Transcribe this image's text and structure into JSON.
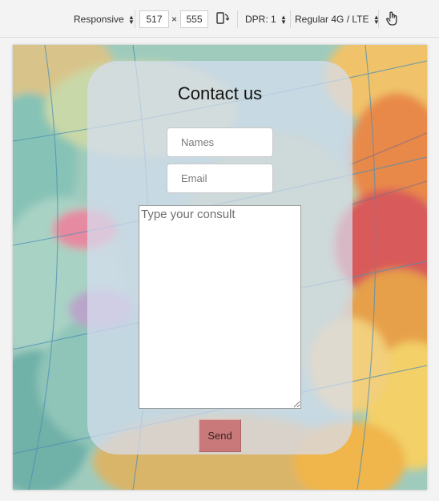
{
  "toolbar": {
    "device_mode": "Responsive",
    "width": "517",
    "times_sign": "×",
    "height": "555",
    "dpr_label": "DPR: 1",
    "throttling": "Regular 4G / LTE",
    "rotate_icon": "rotate-device-icon",
    "touch_icon": "touch-hand-icon"
  },
  "page": {
    "background_image": "vintage world map globe (Europe / North Sea)",
    "form": {
      "title": "Contact us",
      "names_placeholder": "Names",
      "email_placeholder": "Email",
      "consult_placeholder": "Type your consult",
      "send_label": "Send"
    }
  },
  "colors": {
    "card_background": "#d7def0",
    "send_button": "#c97979"
  }
}
